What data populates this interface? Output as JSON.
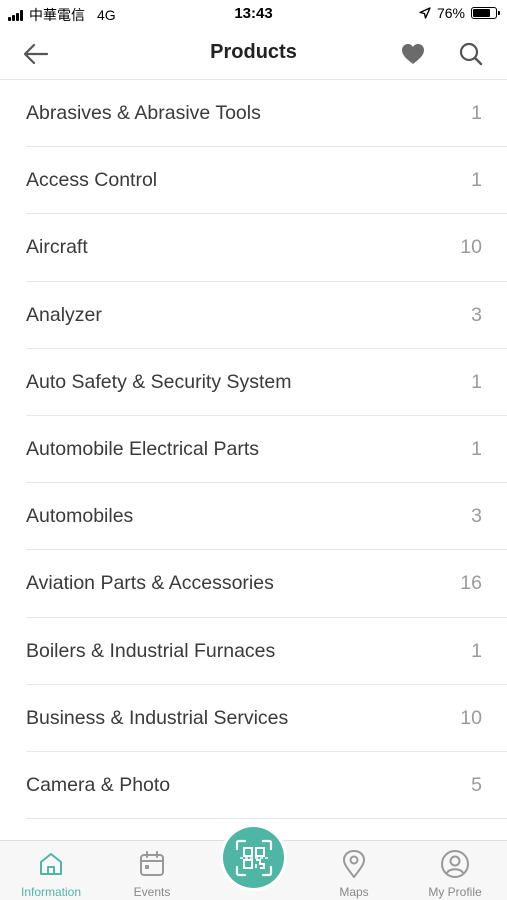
{
  "status_bar": {
    "carrier": "中華電信",
    "network": "4G",
    "time": "13:43",
    "battery_percent": "76%",
    "battery_level": 0.76
  },
  "header": {
    "title": "Products"
  },
  "products": [
    {
      "name": "Abrasives & Abrasive Tools",
      "count": "1"
    },
    {
      "name": "Access Control",
      "count": "1"
    },
    {
      "name": "Aircraft",
      "count": "10"
    },
    {
      "name": "Analyzer",
      "count": "3"
    },
    {
      "name": "Auto Safety & Security System",
      "count": "1"
    },
    {
      "name": "Automobile Electrical Parts",
      "count": "1"
    },
    {
      "name": "Automobiles",
      "count": "3"
    },
    {
      "name": "Aviation Parts & Accessories",
      "count": "16"
    },
    {
      "name": "Boilers & Industrial Furnaces",
      "count": "1"
    },
    {
      "name": "Business & Industrial Services",
      "count": "10"
    },
    {
      "name": "Camera & Photo",
      "count": "5"
    },
    {
      "name": "",
      "count": ""
    }
  ],
  "tabbar": {
    "information": "Information",
    "events": "Events",
    "maps": "Maps",
    "profile": "My Profile",
    "active_color": "#4fb5a5",
    "inactive_color": "#888888"
  },
  "icons": {
    "back": "arrow-left-icon",
    "favorite": "heart-icon",
    "search": "search-icon",
    "scan": "qr-scan-icon"
  }
}
